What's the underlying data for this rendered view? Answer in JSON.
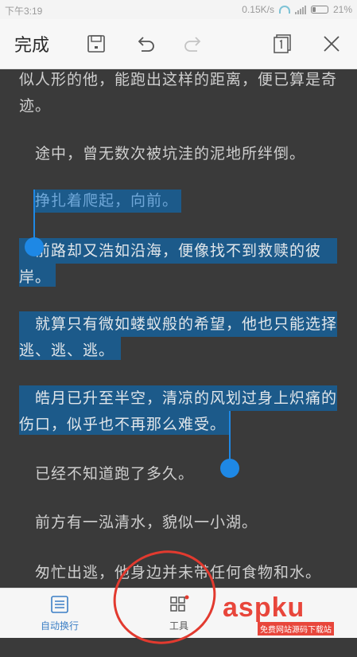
{
  "status_bar": {
    "time": "下午3:19",
    "network_speed": "0.15K/s",
    "battery": "21%"
  },
  "toolbar": {
    "done_label": "完成"
  },
  "document": {
    "paragraphs": [
      "似人形的他，能跑出这样的距离，便已算是奇迹。",
      "途中，曾无数次被坑洼的泥地所绊倒。",
      "挣扎着爬起，向前。",
      "前路却又浩如沿海，便像找不到救赎的彼岸。",
      "就算只有微如蝼蚁般的希望，他也只能选择逃、逃、逃。",
      "皓月已升至半空，清凉的风划过身上炽痛的伤口，似乎也不再那么难受。",
      "已经不知道跑了多久。",
      "前方有一泓清水，貌似一小湖。",
      "匆忙出逃，他身边并未带任何食物和水。"
    ],
    "selection_color": "#1c5a8a",
    "handle_color": "#1e88e5"
  },
  "bottom_bar": {
    "wrap_label": "自动换行",
    "tools_label": "工具"
  },
  "watermark": {
    "logo": "aspku",
    "sub": "免费网站源码下载站"
  }
}
